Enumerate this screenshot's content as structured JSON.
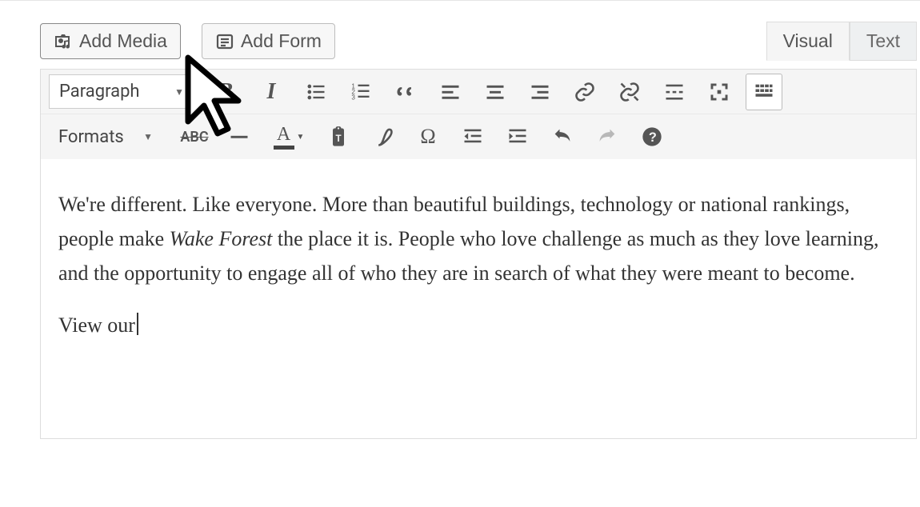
{
  "buttons": {
    "add_media": "Add Media",
    "add_form": "Add Form"
  },
  "tabs": {
    "visual": "Visual",
    "text": "Text"
  },
  "toolbar": {
    "paragraph_dd": "Paragraph",
    "formats_dd": "Formats",
    "bold_glyph": "B",
    "italic_glyph": "I",
    "textcolor_letter": "A"
  },
  "content": {
    "p1_a": "We're different. Like everyone. More than beautiful buildings, technology or national rankings, people make ",
    "p1_em": "Wake Forest",
    "p1_b": " the place it is. People who love challenge as much as they love learning, and the opportunity to engage all of who they are in search of what they were meant to become.",
    "p2": "View our"
  }
}
